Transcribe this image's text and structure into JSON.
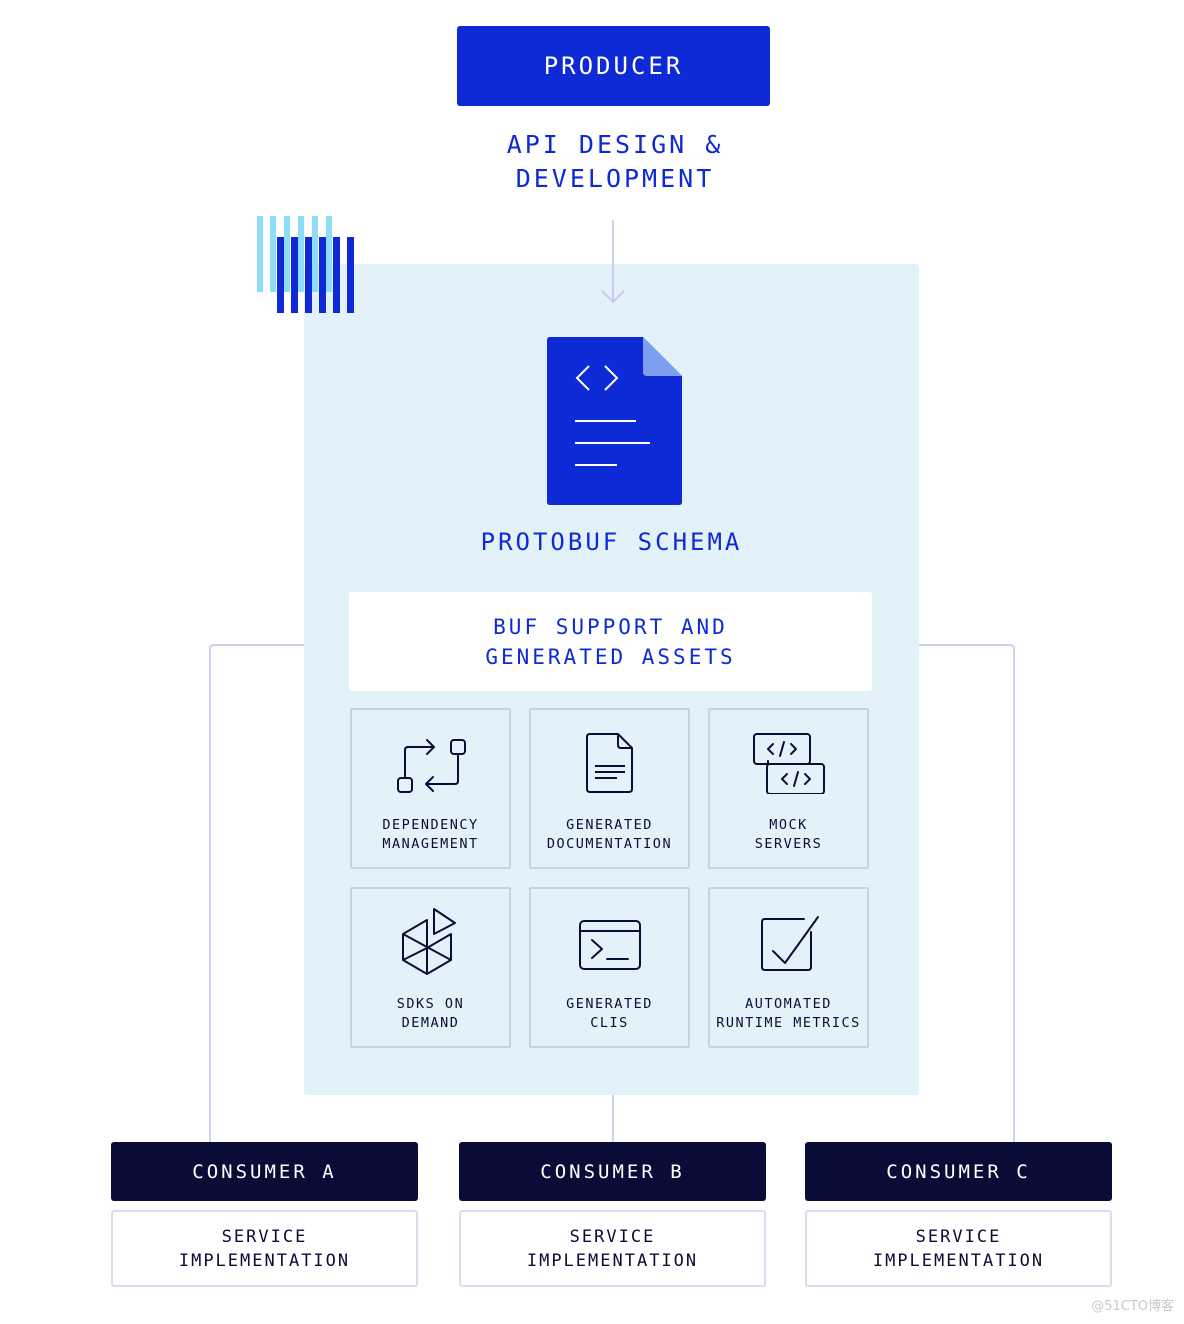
{
  "producer": {
    "label": "PRODUCER"
  },
  "api_design": {
    "label": "API DESIGN &\nDEVELOPMENT"
  },
  "schema": {
    "label": "PROTOBUF SCHEMA",
    "icon": "code-document-icon"
  },
  "buf_support": {
    "label": "BUF SUPPORT AND\nGENERATED ASSETS"
  },
  "tiles": [
    {
      "label": "DEPENDENCY\nMANAGEMENT",
      "icon": "dependency-arrows-icon"
    },
    {
      "label": "GENERATED\nDOCUMENTATION",
      "icon": "document-icon"
    },
    {
      "label": "MOCK\nSERVERS",
      "icon": "code-windows-icon"
    },
    {
      "label": "SDKS ON\nDEMAND",
      "icon": "sdk-cube-icon"
    },
    {
      "label": "GENERATED\nCLIS",
      "icon": "terminal-icon"
    },
    {
      "label": "AUTOMATED\nRUNTIME METRICS",
      "icon": "checkbox-icon"
    }
  ],
  "consumers": [
    {
      "label": "CONSUMER A",
      "service": "SERVICE\nIMPLEMENTATION"
    },
    {
      "label": "CONSUMER B",
      "service": "SERVICE\nIMPLEMENTATION"
    },
    {
      "label": "CONSUMER C",
      "service": "SERVICE\nIMPLEMENTATION"
    }
  ],
  "watermark": "@51CTO博客",
  "colors": {
    "brand_blue": "#0e2ad6",
    "navy": "#0a0c38",
    "panel_bg": "#e3f2f9",
    "connector": "#d0d0f0",
    "stripe_light": "#8fdcf8"
  }
}
